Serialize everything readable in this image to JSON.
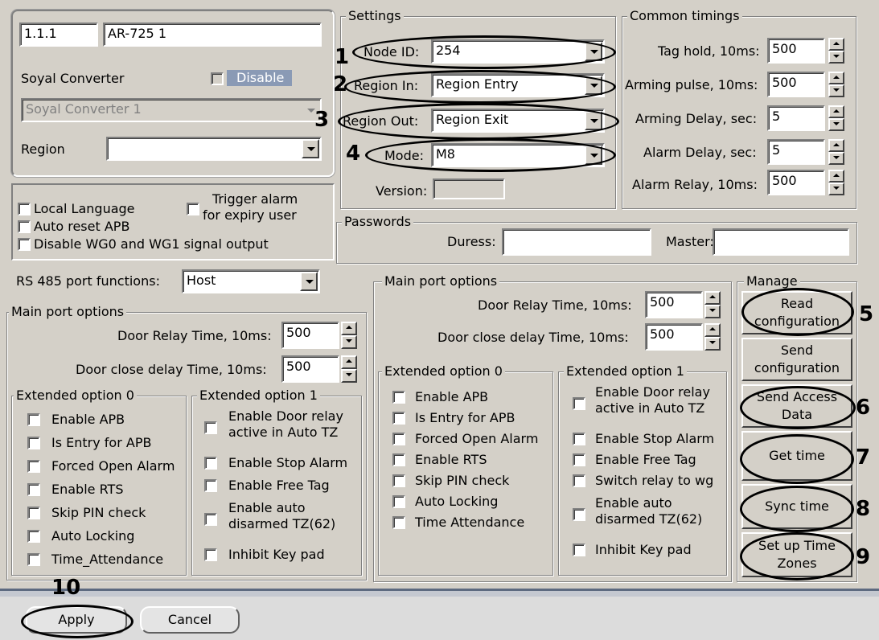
{
  "device": {
    "address": "1.1.1",
    "name": "AR-725 1",
    "converter_label": "Soyal Converter",
    "disable_label": "Disable",
    "converter_value": "Soyal Converter 1",
    "region_label": "Region",
    "region_value": ""
  },
  "settings": {
    "title": "Settings",
    "node_id_label": "Node ID:",
    "node_id": "254",
    "region_in_label": "Region In:",
    "region_in": "Region Entry",
    "region_out_label": "Region Out:",
    "region_out": "Region Exit",
    "mode_label": "Mode:",
    "mode": "M8",
    "version_label": "Version:"
  },
  "timings": {
    "title": "Common timings",
    "items": [
      {
        "label": "Tag hold, 10ms:",
        "value": "500"
      },
      {
        "label": "Arming pulse, 10ms:",
        "value": "500"
      },
      {
        "label": "Arming Delay, sec:",
        "value": "5"
      },
      {
        "label": "Alarm Delay, sec:",
        "value": "5"
      },
      {
        "label": "Alarm Relay, 10ms:",
        "value": "500"
      }
    ]
  },
  "options": {
    "local_language": "Local Language",
    "trigger_alarm_1": "Trigger alarm",
    "trigger_alarm_2": "for expiry user",
    "auto_reset": "Auto reset APB",
    "disable_wg": "Disable WG0 and WG1 signal output",
    "rs485_label": "RS 485 port functions:",
    "rs485_value": "Host"
  },
  "passwords": {
    "title": "Passwords",
    "duress_label": "Duress:",
    "duress": "",
    "master_label": "Master:",
    "master": ""
  },
  "port_left": {
    "title": "Main port options",
    "door_relay_label": "Door Relay Time, 10ms:",
    "door_relay": "500",
    "door_close_label": "Door close delay Time, 10ms:",
    "door_close": "500",
    "ext0_title": "Extended option 0",
    "ext0_items": [
      "Enable APB",
      "Is Entry for APB",
      "Forced Open Alarm",
      "Enable RTS",
      "Skip PIN check",
      "Auto Locking",
      "Time_Attendance"
    ],
    "ext1_title": "Extended option 1",
    "ext1": {
      "door_relay_1": "Enable Door relay",
      "door_relay_2": "active in Auto TZ",
      "stop_alarm": "Enable Stop Alarm",
      "free_tag": "Enable Free Tag",
      "auto_disarm_1": "Enable auto",
      "auto_disarm_2": "disarmed TZ(62)",
      "inhibit": "Inhibit Key pad"
    }
  },
  "port_right": {
    "title": "Main port options",
    "door_relay_label": "Door Relay Time, 10ms:",
    "door_relay": "500",
    "door_close_label": "Door close delay Time, 10ms:",
    "door_close": "500",
    "ext0_title": "Extended option 0",
    "ext0_items": [
      "Enable APB",
      "Is Entry for APB",
      "Forced Open Alarm",
      "Enable RTS",
      "Skip PIN check",
      "Auto Locking",
      "Time Attendance"
    ],
    "ext1_title": "Extended option 1",
    "ext1": {
      "door_relay_1": "Enable Door relay",
      "door_relay_2": "active in Auto TZ",
      "stop_alarm": "Enable Stop Alarm",
      "free_tag": "Enable Free Tag",
      "switch_relay": "Switch relay to wg",
      "auto_disarm_1": "Enable auto",
      "auto_disarm_2": "disarmed TZ(62)",
      "inhibit": "Inhibit Key pad"
    }
  },
  "manage": {
    "title": "Manage",
    "read_1": "Read",
    "read_2": "configuration",
    "send_1": "Send",
    "send_2": "configuration",
    "access_1": "Send Access",
    "access_2": "Data",
    "get_time": "Get time",
    "sync_time": "Sync time",
    "tz_1": "Set up Time",
    "tz_2": "Zones"
  },
  "footer": {
    "apply": "Apply",
    "cancel": "Cancel"
  },
  "callouts": [
    "1",
    "2",
    "3",
    "4",
    "5",
    "6",
    "7",
    "8",
    "9",
    "10"
  ]
}
